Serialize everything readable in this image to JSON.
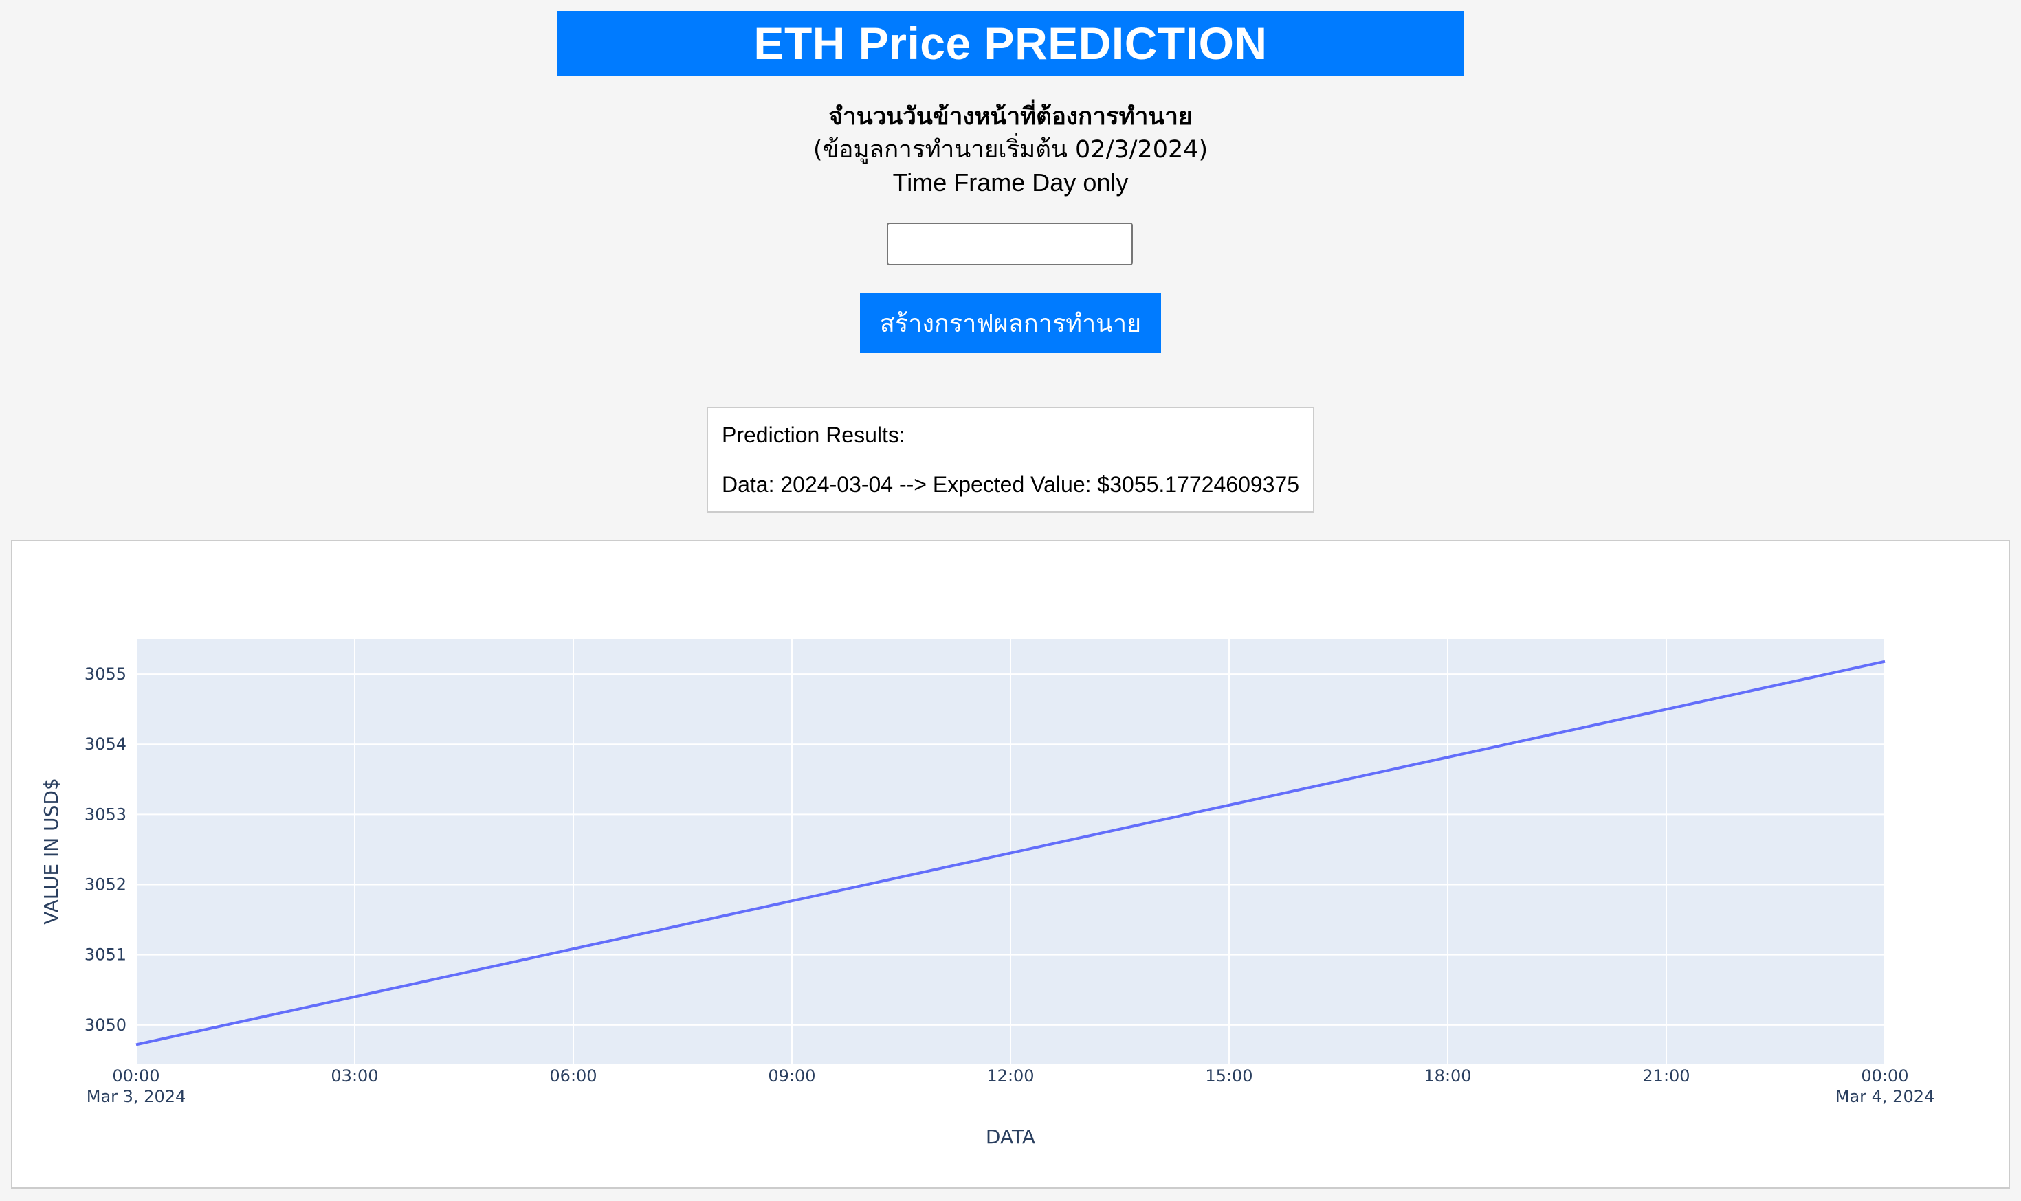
{
  "header": {
    "title": "ETH Price PREDICTION"
  },
  "form": {
    "prompt_line1": "จำนวนวันข้างหน้าที่ต้องการทำนาย",
    "prompt_line2": "(ข้อมูลการทำนายเริ่มต้น 02/3/2024)",
    "prompt_line3": "Time Frame Day only",
    "days_value": "",
    "days_placeholder": "",
    "submit_label": "สร้างกราฟผลการทำนาย"
  },
  "results": {
    "heading": "Prediction Results:",
    "line": "Data: 2024-03-04 --> Expected Value: $3055.17724609375"
  },
  "colors": {
    "accent": "#007bff",
    "plot_bg": "#e5ecf6",
    "line": "#636efa",
    "axis_text": "#2a3f5f"
  },
  "chart_data": {
    "type": "line",
    "title": "",
    "xlabel": "DATA",
    "ylabel": "VALUE IN USD$",
    "x_ticks": [
      {
        "value": "2024-03-03 00:00",
        "label": "00:00",
        "sub": "Mar 3, 2024"
      },
      {
        "value": "2024-03-03 03:00",
        "label": "03:00",
        "sub": ""
      },
      {
        "value": "2024-03-03 06:00",
        "label": "06:00",
        "sub": ""
      },
      {
        "value": "2024-03-03 09:00",
        "label": "09:00",
        "sub": ""
      },
      {
        "value": "2024-03-03 12:00",
        "label": "12:00",
        "sub": ""
      },
      {
        "value": "2024-03-03 15:00",
        "label": "15:00",
        "sub": ""
      },
      {
        "value": "2024-03-03 18:00",
        "label": "18:00",
        "sub": ""
      },
      {
        "value": "2024-03-03 21:00",
        "label": "21:00",
        "sub": ""
      },
      {
        "value": "2024-03-04 00:00",
        "label": "00:00",
        "sub": "Mar 4, 2024"
      }
    ],
    "y_ticks": [
      3050,
      3051,
      3052,
      3053,
      3054,
      3055
    ],
    "xlim": [
      "2024-03-03 00:00",
      "2024-03-04 00:00"
    ],
    "ylim": [
      3049.45,
      3055.5
    ],
    "grid": true,
    "series": [
      {
        "x": [
          "2024-03-03 00:00",
          "2024-03-04 00:00"
        ],
        "y": [
          3049.72,
          3055.18
        ]
      }
    ]
  }
}
